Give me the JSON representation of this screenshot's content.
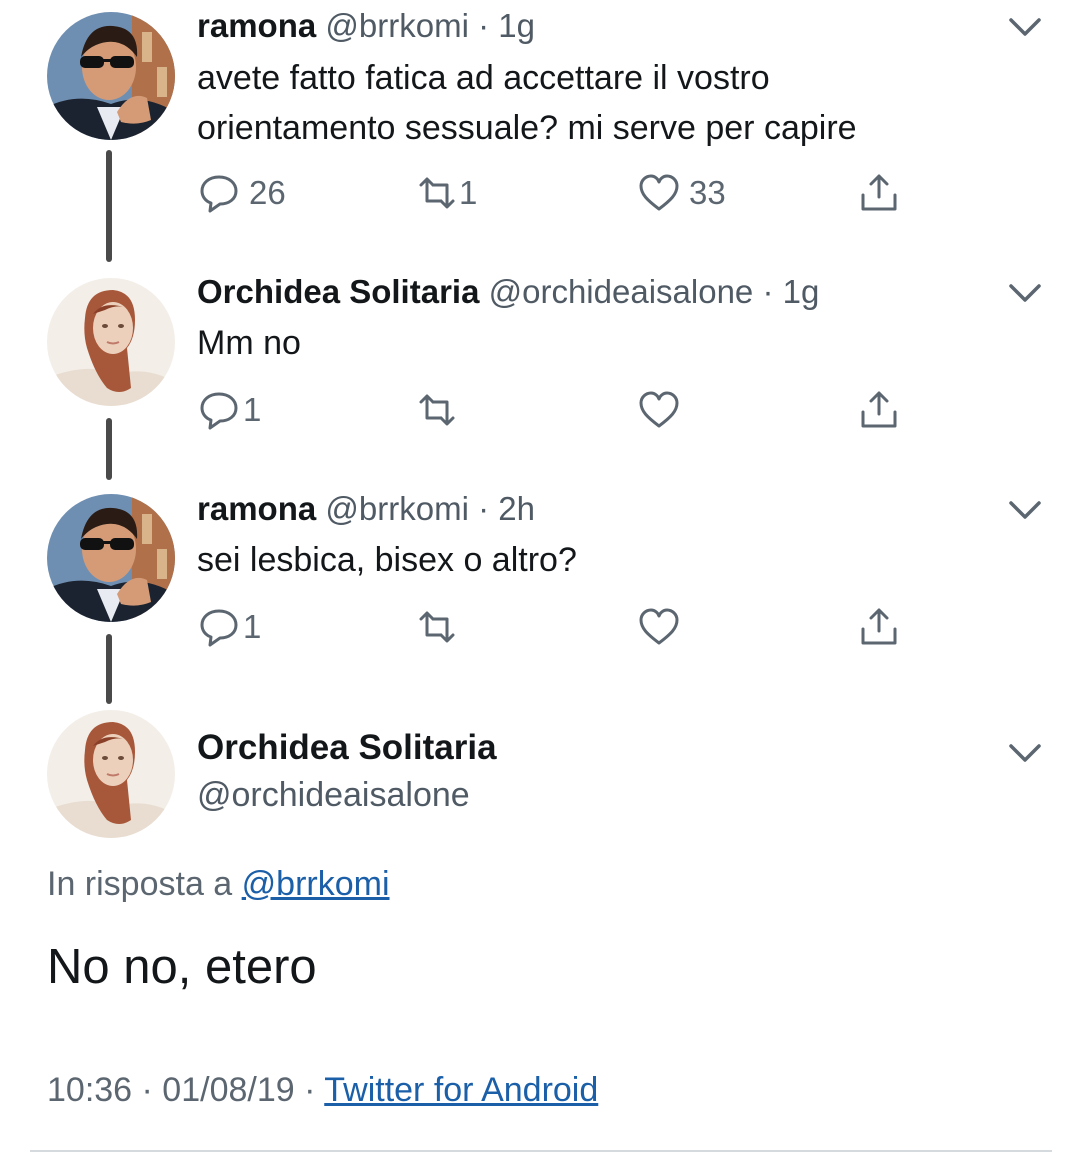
{
  "colors": {
    "accent": "#1b5fa8",
    "thread_line": "#4a4a4a",
    "muted": "#5b6670"
  },
  "tweets": [
    {
      "name": "ramona",
      "meta": "@brrkomi · 1g",
      "lines": [
        "avete fatto fatica ad accettare il vostro",
        "orientamento sessuale? mi serve per capire"
      ],
      "replies": "26",
      "retweets": "1",
      "likes": "33",
      "avatar_icon": "avatar-ramona"
    },
    {
      "name": "Orchidea Solitaria",
      "meta": "@orchideaisalone · 1g",
      "lines": [
        "Mm no"
      ],
      "replies": "1",
      "retweets": "",
      "likes": "",
      "avatar_icon": "avatar-orchidea"
    },
    {
      "name": "ramona",
      "meta": "@brrkomi · 2h",
      "lines": [
        "sei lesbica, bisex o altro?"
      ],
      "replies": "1",
      "retweets": "",
      "likes": "",
      "avatar_icon": "avatar-ramona"
    }
  ],
  "focused": {
    "name": "Orchidea Solitaria",
    "handle": "@orchideaisalone",
    "reply_prefix": "In risposta a ",
    "reply_to": "@brrkomi",
    "text": "No no, etero",
    "time": "10:36 · 01/08/19 · ",
    "source": "Twitter for Android"
  }
}
